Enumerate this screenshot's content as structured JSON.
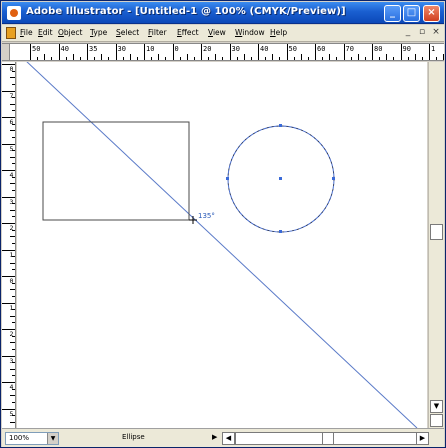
{
  "window": {
    "title": "Adobe Illustrator - [Untitled-1 @ 100% (CMYK/Preview)]",
    "minimize": "_",
    "maximize": "□",
    "close": "×"
  },
  "menubar": {
    "items": [
      "File",
      "Edit",
      "Object",
      "Type",
      "Select",
      "Filter",
      "Effect",
      "View",
      "Window",
      "Help"
    ],
    "doc_min": "_",
    "doc_max": "▫",
    "doc_close": "×"
  },
  "hruler": {
    "labels": [
      "50",
      "40",
      "35",
      "30",
      "10",
      "0",
      "20",
      "30",
      "40",
      "50",
      "60",
      "70",
      "80",
      "90",
      "1"
    ]
  },
  "vruler": {
    "labels": [
      "0",
      "7",
      "6",
      "5",
      "4",
      "3",
      "2",
      "1",
      "0",
      "1",
      "2",
      "3",
      "4",
      "5"
    ]
  },
  "canvas": {
    "angle_readout": "135°",
    "colors": {
      "rectangle_stroke": "#4a4a4a",
      "circle_stroke": "#4a6fd0",
      "line_stroke": "#5a7ac8",
      "selection": "#3a6ad8"
    }
  },
  "statusbar": {
    "zoom": "100%",
    "status": "Ellipse",
    "status_arrow": "▶"
  },
  "scrollbar": {
    "up": "▲",
    "down": "▼",
    "left": "◀",
    "right": "▶"
  }
}
